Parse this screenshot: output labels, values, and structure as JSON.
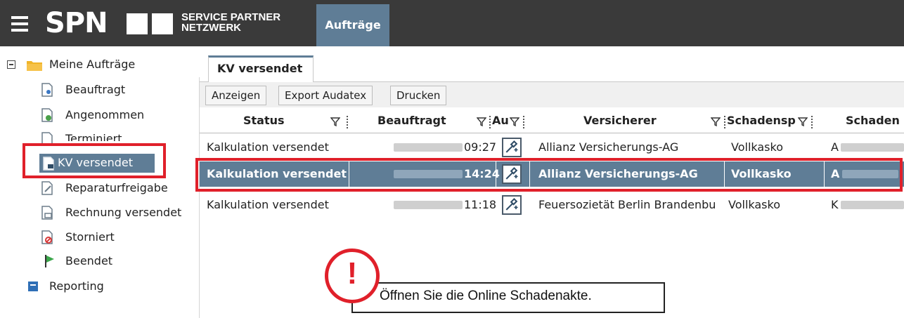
{
  "header": {
    "logo_main": "SPN",
    "logo_sub_line1": "SERVICE PARTNER",
    "logo_sub_line2": "NETZWERK",
    "nav_tab": "Aufträge"
  },
  "sidebar": {
    "root_label": "Meine Aufträge",
    "items": [
      {
        "label": "Beauftragt",
        "icon": "document-person-icon"
      },
      {
        "label": "Angenommen",
        "icon": "document-check-icon"
      },
      {
        "label": "Terminiert",
        "icon": "document-calendar-icon"
      },
      {
        "label": "KV versendet",
        "icon": "document-send-icon"
      },
      {
        "label": "Reparaturfreigabe",
        "icon": "document-edit-icon"
      },
      {
        "label": "Rechnung versendet",
        "icon": "document-invoice-icon"
      },
      {
        "label": "Storniert",
        "icon": "document-cancel-icon"
      },
      {
        "label": "Beendet",
        "icon": "flag-icon"
      }
    ],
    "reporting_label": "Reporting",
    "selected": "KV versendet"
  },
  "main": {
    "active_tab": "KV versendet",
    "toolbar": {
      "show": "Anzeigen",
      "export": "Export Audatex",
      "print": "Drucken"
    },
    "columns": [
      "Status",
      "Beauftragt",
      "Au",
      "Versicherer",
      "Schadensp",
      "Schaden"
    ],
    "rows": [
      {
        "status": "Kalkulation versendet",
        "time": "09:27",
        "insurer": "Allianz Versicherungs-AG",
        "damage_type": "Vollkasko",
        "damage_prefix": "A"
      },
      {
        "status": "Kalkulation versendet",
        "time": "14:24",
        "insurer": "Allianz Versicherungs-AG",
        "damage_type": "Vollkasko",
        "damage_prefix": "A"
      },
      {
        "status": "Kalkulation versendet",
        "time": "11:18",
        "insurer": "Feuersozietät Berlin Brandenbu",
        "damage_type": "Vollkasko",
        "damage_prefix": "K"
      }
    ]
  },
  "annotation": {
    "mark": "!",
    "text": "Öffnen Sie die Online Schadenakte."
  },
  "colors": {
    "topbar": "#3a3a3a",
    "accent": "#5f7d96",
    "highlight_red": "#e0202a"
  }
}
